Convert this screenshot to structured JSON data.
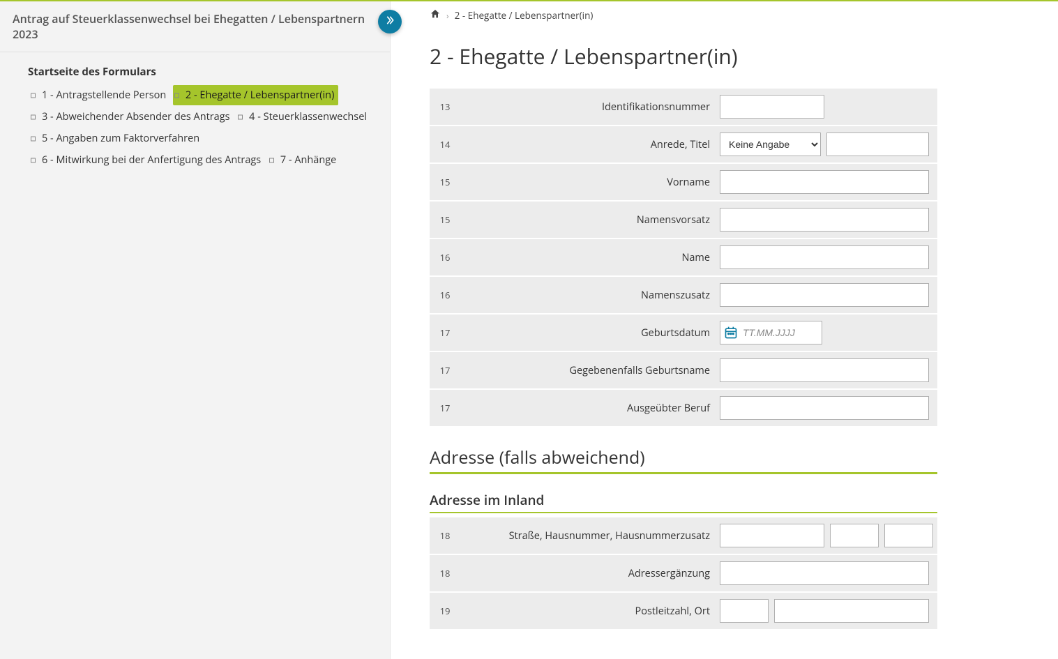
{
  "sidebar": {
    "title": "Antrag auf Steuerklassenwechsel bei Ehegatten / Lebenspartnern  2023",
    "heading": "Startseite des Formulars",
    "items": [
      {
        "label": "1 - Antragstellende Person",
        "active": false
      },
      {
        "label": "2 - Ehegatte / Lebenspartner(in)",
        "active": true
      },
      {
        "label": "3 - Abweichender Absender des Antrags",
        "active": false
      },
      {
        "label": "4 - Steuerklassenwechsel",
        "active": false
      },
      {
        "label": "5 - Angaben zum Faktorverfahren",
        "active": false
      },
      {
        "label": "6 - Mitwirkung bei der Anfertigung des Antrags",
        "active": false
      },
      {
        "label": "7 - Anhänge",
        "active": false
      }
    ]
  },
  "breadcrumb": {
    "page": "2 - Ehegatte / Lebenspartner(in)"
  },
  "page": {
    "title": "2 - Ehegatte / Lebenspartner(in)",
    "section_address": "Adresse (falls abweichend)",
    "subsection_inland": "Adresse im Inland"
  },
  "rows": {
    "r13": {
      "num": "13",
      "label": "Identifikationsnummer"
    },
    "r14": {
      "num": "14",
      "label": "Anrede,  Titel",
      "select_default": "Keine Angabe"
    },
    "r15a": {
      "num": "15",
      "label": "Vorname"
    },
    "r15b": {
      "num": "15",
      "label": "Namensvorsatz"
    },
    "r16a": {
      "num": "16",
      "label": "Name"
    },
    "r16b": {
      "num": "16",
      "label": "Namenszusatz"
    },
    "r17a": {
      "num": "17",
      "label": "Geburtsdatum",
      "placeholder": "TT.MM.JJJJ"
    },
    "r17b": {
      "num": "17",
      "label": "Gegebenenfalls Geburtsname"
    },
    "r17c": {
      "num": "17",
      "label": "Ausgeübter Beruf"
    },
    "r18a": {
      "num": "18",
      "label": "Straße,  Hausnummer,  Hausnummerzusatz"
    },
    "r18b": {
      "num": "18",
      "label": "Adressergänzung"
    },
    "r19": {
      "num": "19",
      "label": "Postleitzahl,  Ort"
    }
  }
}
